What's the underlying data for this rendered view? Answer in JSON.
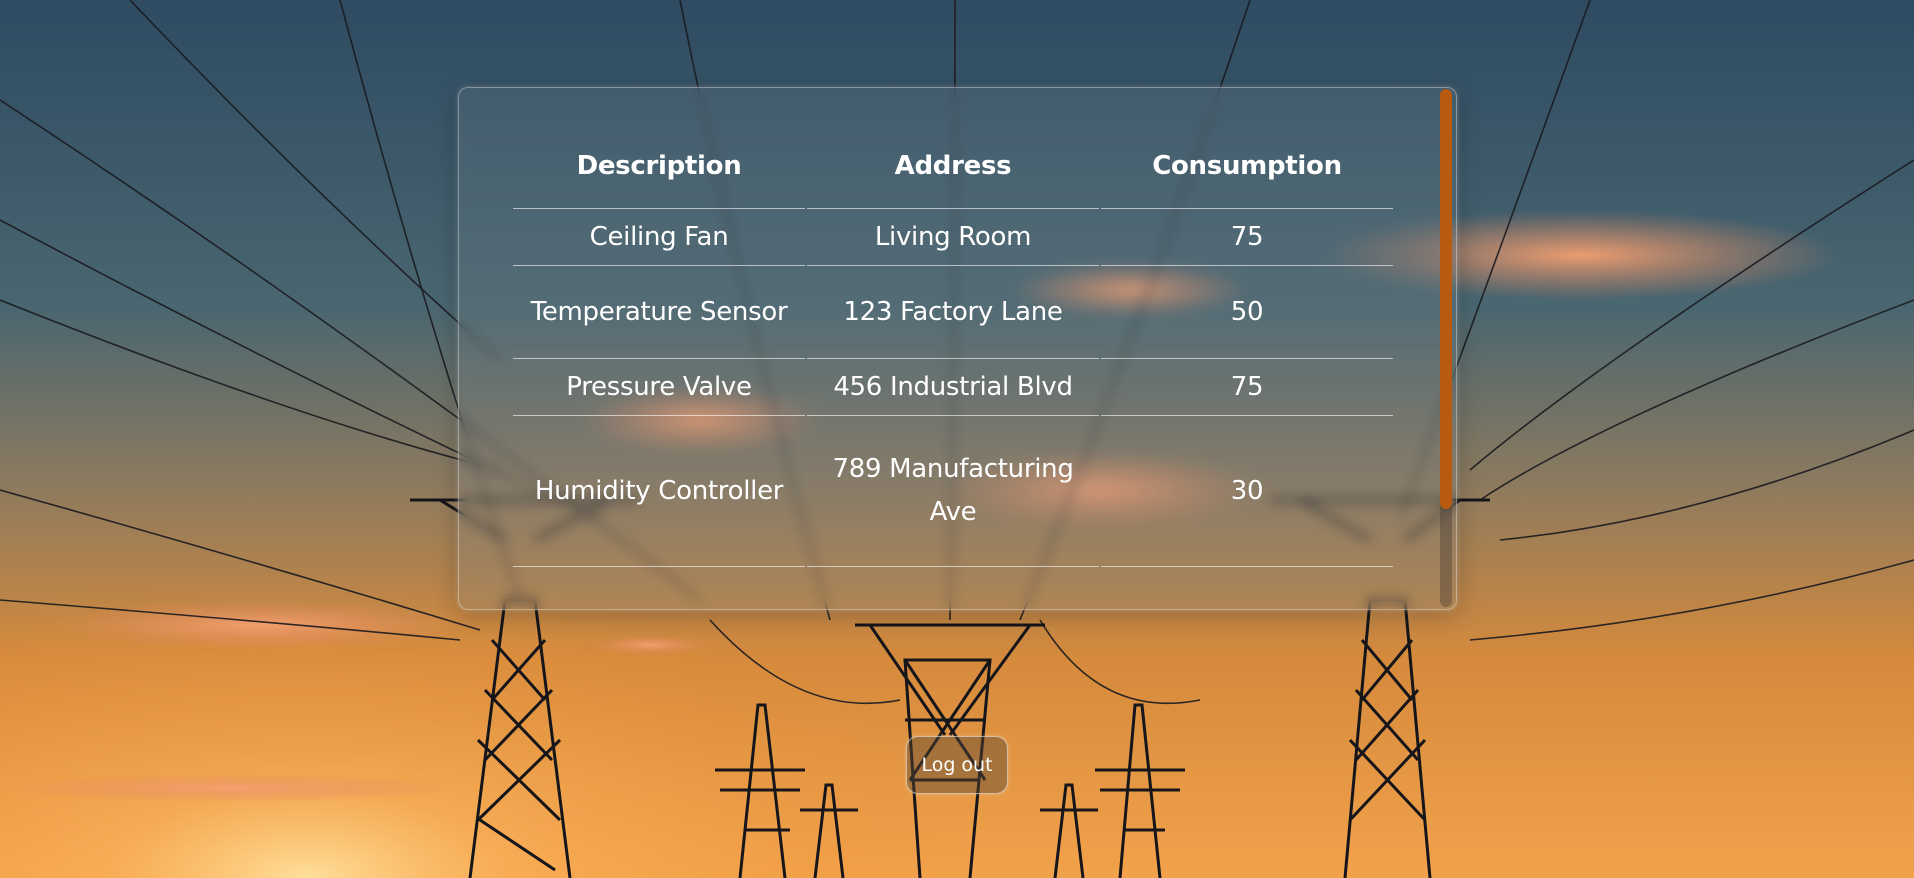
{
  "table": {
    "headers": [
      "Description",
      "Address",
      "Consumption"
    ],
    "rows": [
      {
        "description": "Ceiling Fan",
        "address": "Living Room",
        "consumption": "75"
      },
      {
        "description": "Temperature Sensor",
        "address": "123 Factory Lane",
        "consumption": "50"
      },
      {
        "description": "Pressure Valve",
        "address": "456 Industrial Blvd",
        "consumption": "75"
      },
      {
        "description": "Humidity Controller",
        "address": "789 Manufacturing Ave",
        "consumption": "30"
      }
    ]
  },
  "scrollbar": {
    "position_fraction": 0.0,
    "visible_fraction": 0.81
  },
  "logout_label": "Log out",
  "colors": {
    "accent": "#b85a10",
    "sky_top": "#2f4d63",
    "sky_horizon": "#f0962e",
    "text": "#ffffff"
  },
  "background": {
    "icon": "power-lines-sunset-photo"
  }
}
